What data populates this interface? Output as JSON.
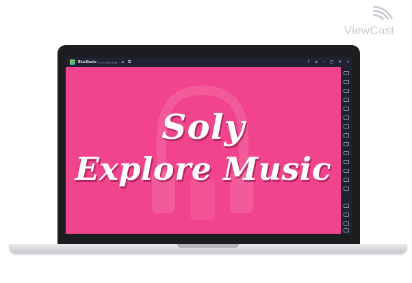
{
  "watermark": {
    "text": "ViewCast",
    "icon": "wifi-signal-icon"
  },
  "window": {
    "app_name": "BlueStacks",
    "version": "5.4.0.1063 Beta",
    "left_icons": [
      "home-icon",
      "multi-instance-icon"
    ],
    "right_icons": [
      "help-icon",
      "menu-icon",
      "minimize-icon",
      "maximize-icon",
      "close-icon",
      "collapse-icon"
    ]
  },
  "app_screen": {
    "line1": "Soly",
    "line2": "Explore Music",
    "background": "#f2448c"
  },
  "sidebar": {
    "icons": [
      "fullscreen-icon",
      "volume-up-icon",
      "volume-down-icon",
      "screen-record-icon",
      "keyboard-icon",
      "screenshot-icon",
      "rotate-icon",
      "shake-icon",
      "macro-icon",
      "location-icon",
      "folder-icon",
      "multi-instance-icon",
      "eco-mode-icon",
      "sync-icon",
      "settings-icon",
      "back-icon",
      "home-icon",
      "recent-apps-icon"
    ]
  }
}
